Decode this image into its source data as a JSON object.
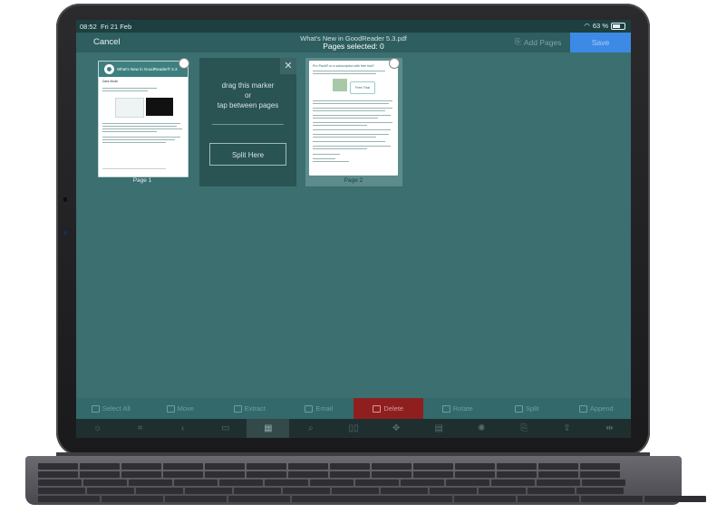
{
  "status": {
    "time": "08:52",
    "date": "Fri 21 Feb",
    "battery": "63 %",
    "battery_level": 0.63
  },
  "nav": {
    "cancel_label": "Cancel",
    "title": "What's New in GoodReader 5.3.pdf",
    "subtitle": "Pages selected: 0",
    "add_pages_label": "Add Pages",
    "save_label": "Save"
  },
  "pages": [
    {
      "label": "Page 1",
      "header_text": "What's New in GoodReader® 5.3",
      "intro": "Dark Mode"
    },
    {
      "label": "Page 2",
      "header_text": "Pro Pack® or a subscription with free trial?",
      "badge": "Free Trial"
    }
  ],
  "split_marker": {
    "line1": "drag this marker",
    "line2": "or",
    "line3": "tap between pages",
    "close_glyph": "✕",
    "split_button": "Split Here"
  },
  "actions": [
    {
      "label": "Select All",
      "icon": "select-all-icon"
    },
    {
      "label": "Move",
      "icon": "move-icon"
    },
    {
      "label": "Extract",
      "icon": "extract-icon"
    },
    {
      "label": "Email",
      "icon": "email-icon"
    },
    {
      "label": "Delete",
      "icon": "trash-icon"
    },
    {
      "label": "Rotate",
      "icon": "rotate-icon"
    },
    {
      "label": "Split",
      "icon": "split-icon"
    },
    {
      "label": "Append",
      "icon": "append-icon"
    }
  ],
  "toolbar": [
    {
      "icon": "brightness-icon",
      "glyph": "☼"
    },
    {
      "icon": "crop-icon",
      "glyph": "⌗"
    },
    {
      "icon": "back-icon",
      "glyph": "‹"
    },
    {
      "icon": "book-icon",
      "glyph": "▭"
    },
    {
      "icon": "grid-icon",
      "glyph": "▦"
    },
    {
      "icon": "search-icon",
      "glyph": "⌕"
    },
    {
      "icon": "two-pages-icon",
      "glyph": "▯▯"
    },
    {
      "icon": "pan-icon",
      "glyph": "✥"
    },
    {
      "icon": "document-icon",
      "glyph": "▤"
    },
    {
      "icon": "settings-icon",
      "glyph": "✺"
    },
    {
      "icon": "file-settings-icon",
      "glyph": "⎘"
    },
    {
      "icon": "share-icon",
      "glyph": "⇪"
    },
    {
      "icon": "resize-icon",
      "glyph": "⇹"
    }
  ],
  "colors": {
    "background": "#3b6f70",
    "delete": "#8f1f1f",
    "save": "#3d8ae6"
  }
}
